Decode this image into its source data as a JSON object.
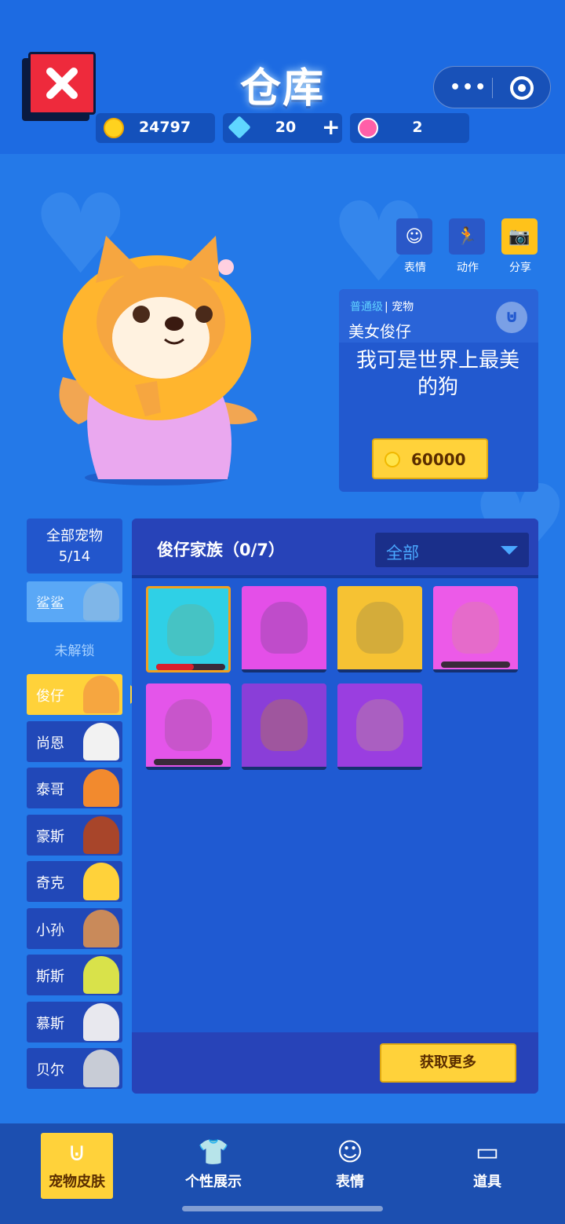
{
  "header": {
    "title": "仓库",
    "close_label": "✖",
    "menu_dots": "•••",
    "currencies": [
      {
        "icon": "gold-coin-icon",
        "value": "24797",
        "color": "#ffd21f"
      },
      {
        "icon": "diamond-icon",
        "value": "20",
        "plus": "+",
        "color": "#5fd6ff"
      },
      {
        "icon": "lotus-token-icon",
        "value": "2",
        "color": "#ff5fa8"
      }
    ]
  },
  "actions": [
    {
      "icon": "emote-icon",
      "label": "表情",
      "glyph": "☺"
    },
    {
      "icon": "action-icon",
      "label": "动作",
      "glyph": "🏃"
    },
    {
      "icon": "camera-icon",
      "label": "分享",
      "glyph": "📷"
    }
  ],
  "pet_card": {
    "rank": "普通级",
    "type": "| 宠物",
    "name": "美女俊仔",
    "quote": "我可是世界上最美的狗",
    "price": "60000",
    "badge_glyph": "⊍"
  },
  "sidebar": {
    "all_label": "全部宠物",
    "all_count": "5/14",
    "locked_label": "未解锁",
    "items": [
      {
        "label": "鲨鲨",
        "state": "locked",
        "color": "#7fb6e8"
      },
      {
        "label": "俊仔",
        "state": "selected",
        "color": "#f6a640"
      },
      {
        "label": "尚恩",
        "state": "normal",
        "color": "#f2f2f2"
      },
      {
        "label": "泰哥",
        "state": "normal",
        "color": "#f28a2e"
      },
      {
        "label": "豪斯",
        "state": "normal",
        "color": "#a8452a"
      },
      {
        "label": "奇克",
        "state": "normal",
        "color": "#ffd23a"
      },
      {
        "label": "小孙",
        "state": "normal",
        "color": "#c98a5a"
      },
      {
        "label": "斯斯",
        "state": "normal",
        "color": "#d9e24a"
      },
      {
        "label": "慕斯",
        "state": "normal",
        "color": "#e8e8ee"
      },
      {
        "label": "贝尔",
        "state": "normal",
        "color": "#c8ccd6"
      }
    ]
  },
  "panel": {
    "title": "俊仔家族（0/7）",
    "filter_value": "全部",
    "more_label": "获取更多",
    "skins": [
      {
        "bg": "#2fd0e6",
        "pet": "#5ab8a8",
        "progress": 0.55,
        "selected": true
      },
      {
        "bg": "#e44fe8",
        "pet": "#a04ab0",
        "progress": null,
        "selected": false
      },
      {
        "bg": "#f6c233",
        "pet": "#b89a40",
        "progress": null,
        "selected": false
      },
      {
        "bg": "#ec5ae8",
        "pet": "#e07ab0",
        "progress": 0,
        "selected": false
      },
      {
        "bg": "#e455ea",
        "pet": "#b055b0",
        "progress": 0,
        "selected": false
      },
      {
        "bg": "#8a3ed8",
        "pet": "#b06a70",
        "progress": null,
        "selected": false
      },
      {
        "bg": "#9a3ee0",
        "pet": "#b87aa8",
        "progress": null,
        "selected": false
      }
    ]
  },
  "nav": [
    {
      "icon": "pet-skin-icon",
      "label": "宠物皮肤",
      "glyph": "⊍",
      "active": true
    },
    {
      "icon": "tshirt-icon",
      "label": "个性展示",
      "glyph": "👕",
      "active": false
    },
    {
      "icon": "emote-icon",
      "label": "表情",
      "glyph": "☺",
      "active": false
    },
    {
      "icon": "card-icon",
      "label": "道具",
      "glyph": "▭",
      "active": false
    }
  ],
  "colors": {
    "accent": "#ffd23a",
    "bg": "#2479e8",
    "panel": "#1f5ad2"
  }
}
